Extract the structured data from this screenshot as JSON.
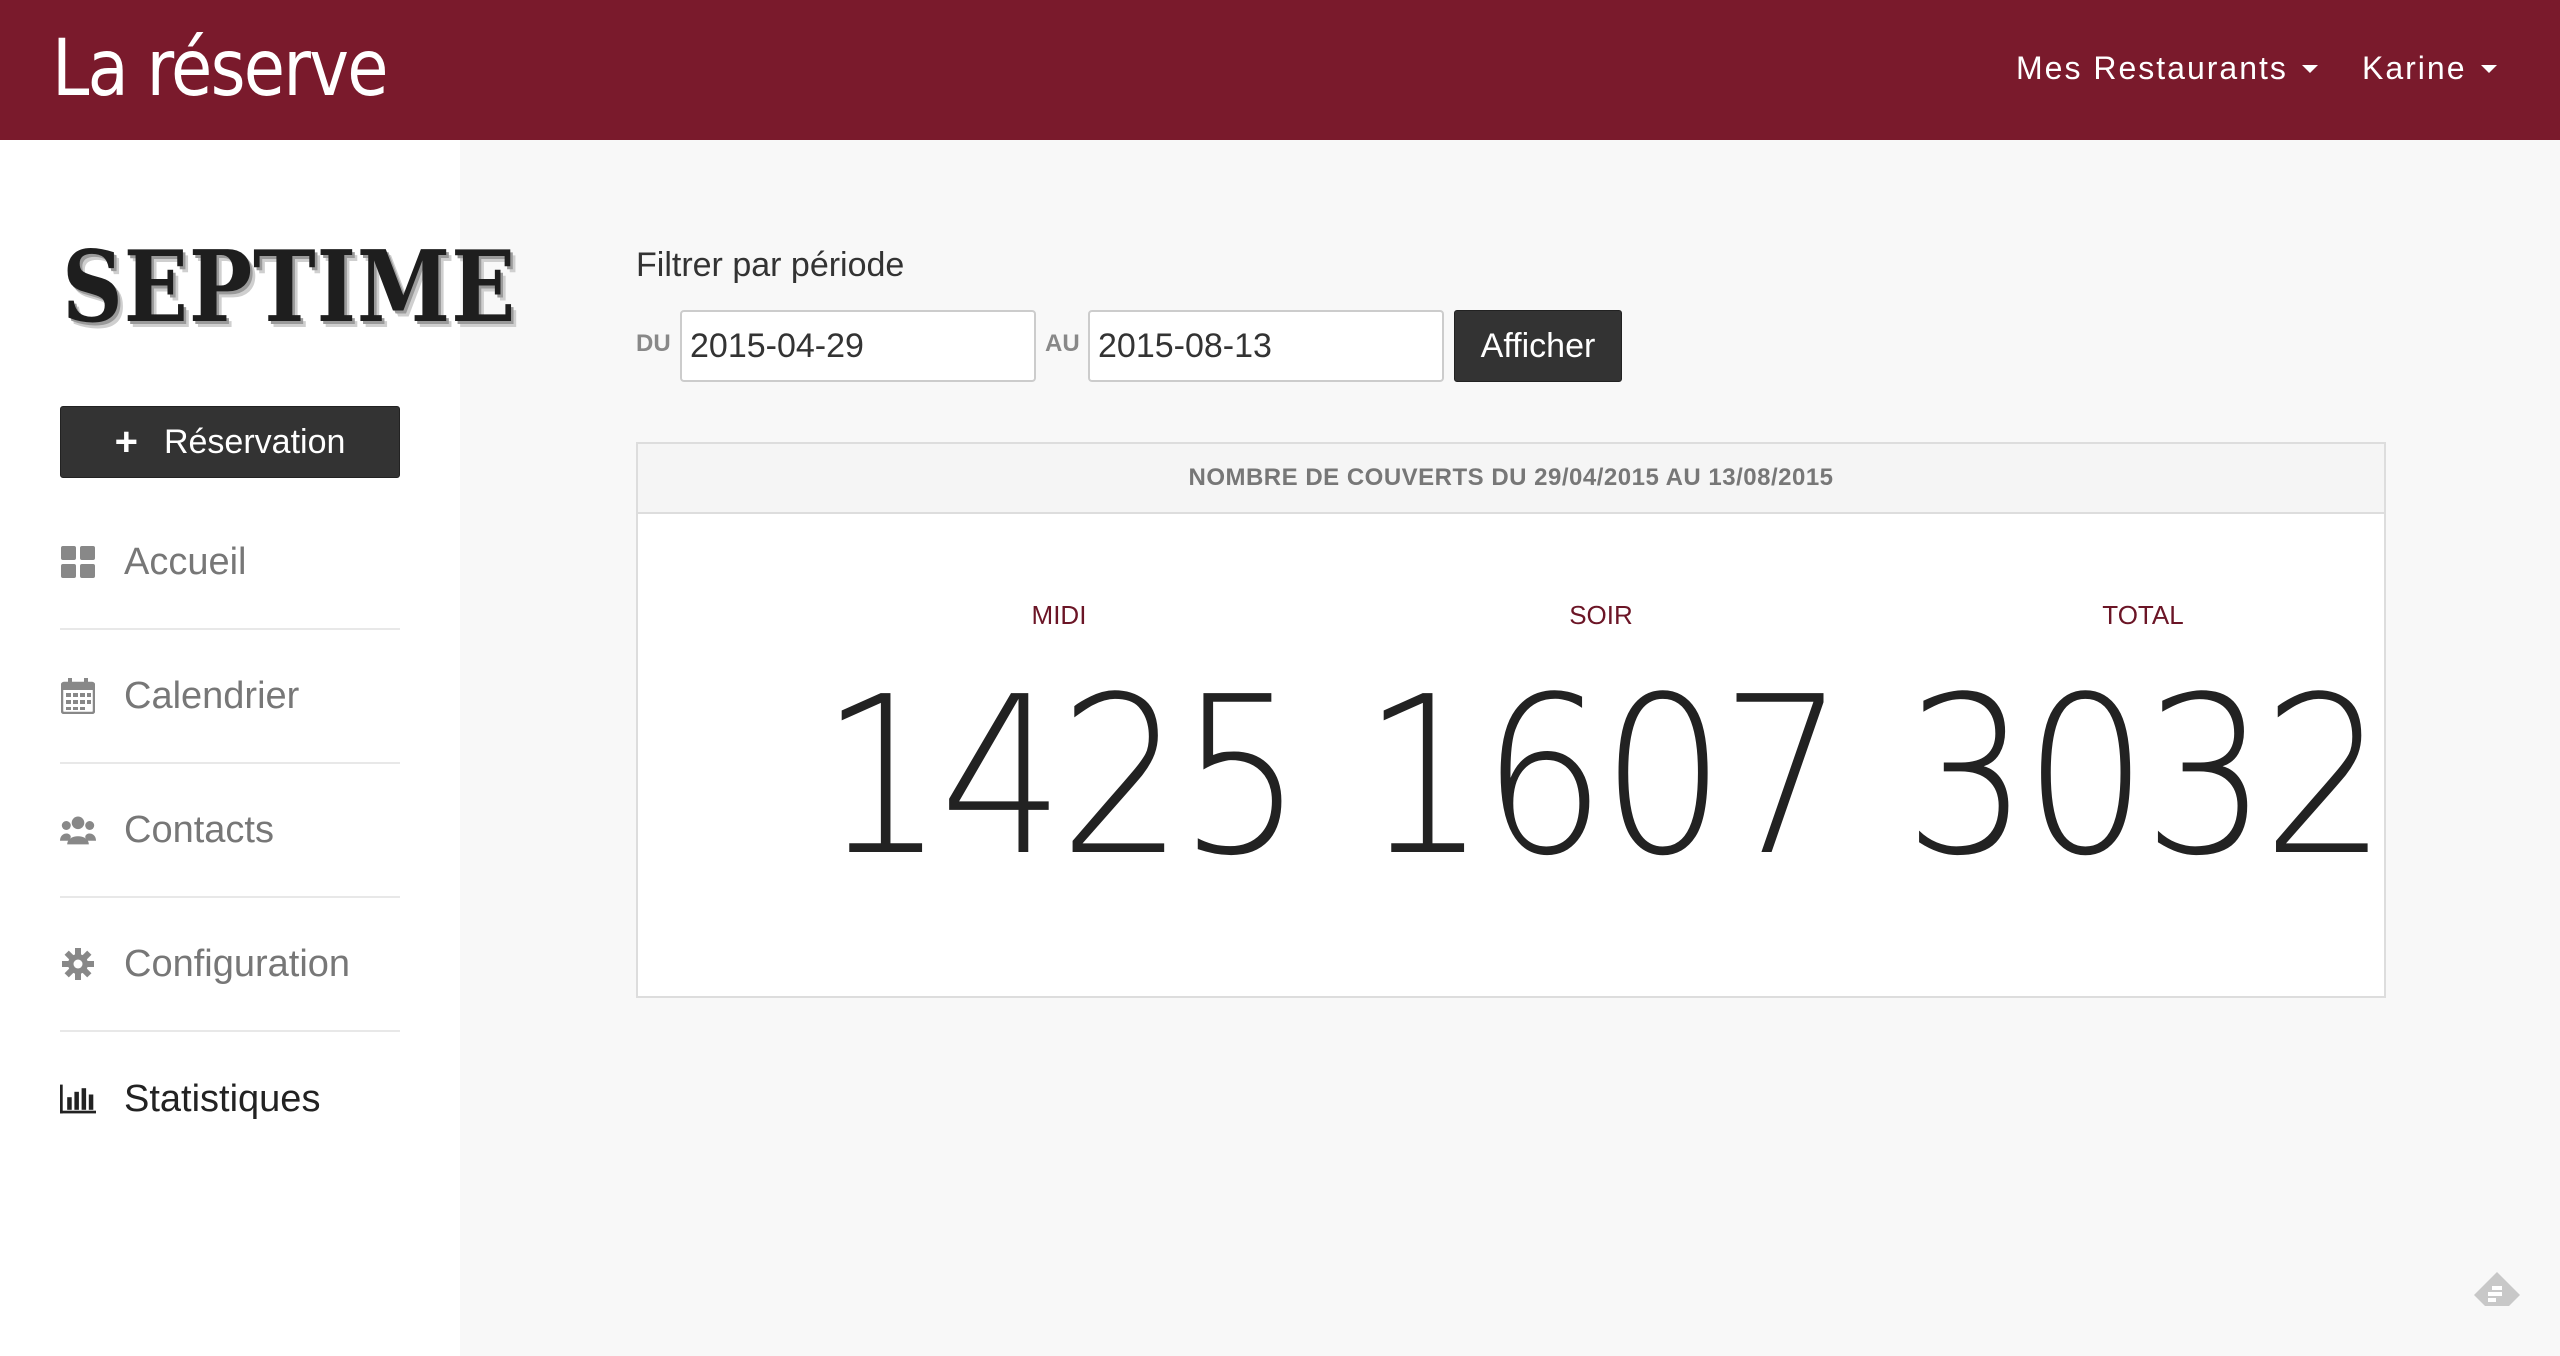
{
  "header": {
    "brand": "La réserve",
    "restaurants_menu": "Mes Restaurants",
    "user_menu": "Karine"
  },
  "sidebar": {
    "logo_text": "SEPTIME",
    "reservation_button": "Réservation",
    "items": [
      {
        "label": "Accueil",
        "icon": "dashboard-icon"
      },
      {
        "label": "Calendrier",
        "icon": "calendar-icon"
      },
      {
        "label": "Contacts",
        "icon": "users-icon"
      },
      {
        "label": "Configuration",
        "icon": "gear-icon"
      },
      {
        "label": "Statistiques",
        "icon": "bar-chart-icon",
        "active": true
      }
    ]
  },
  "filter": {
    "title": "Filtrer par période",
    "from_label": "DU",
    "from_value": "2015-04-29",
    "to_label": "AU",
    "to_value": "2015-08-13",
    "submit_label": "Afficher"
  },
  "stats": {
    "heading": "NOMBRE DE COUVERTS DU 29/04/2015 AU 13/08/2015",
    "midi_label": "MIDI",
    "midi_value": "1425",
    "soir_label": "SOIR",
    "soir_value": "1607",
    "total_label": "TOTAL",
    "total_value": "3032"
  },
  "colors": {
    "brand": "#7a1a2c",
    "button": "#333333",
    "stat_label": "#6b1526"
  }
}
